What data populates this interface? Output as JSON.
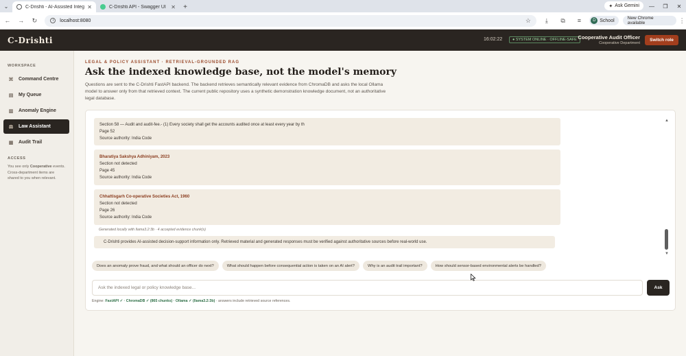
{
  "browser": {
    "tabs": [
      {
        "title": "C-Drishti - AI-Assisted Integrat",
        "active": true
      },
      {
        "title": "C-Drishti API - Swagger UI",
        "active": false
      }
    ],
    "ask_gemini": "Ask Gemini",
    "url": "localhost:8080",
    "profile_initial": "D",
    "profile_label": "School",
    "new_chrome": "New Chrome available"
  },
  "app": {
    "brand": "C-Drishti",
    "clock": "16:02:22",
    "system_status": "● SYSTEM ONLINE · OFFLINE-SAFE",
    "officer_name": "Cooperative Audit Officer",
    "officer_dept": "Cooperative Department",
    "switch_role": "Switch role"
  },
  "sidebar": {
    "section": "WORKSPACE",
    "items": [
      {
        "label": "Command Centre",
        "icon": "command-icon",
        "active": false
      },
      {
        "label": "My Queue",
        "icon": "queue-icon",
        "active": false
      },
      {
        "label": "Anomaly Engine",
        "icon": "chart-icon",
        "active": false
      },
      {
        "label": "Law Assistant",
        "icon": "scales-icon",
        "active": true
      },
      {
        "label": "Audit Trail",
        "icon": "trail-icon",
        "active": false
      }
    ],
    "access_title": "ACCESS",
    "access_pre": "You see only ",
    "access_role": "Cooperative",
    "access_post": " events. Cross-department items are shared to you when relevant."
  },
  "page": {
    "eyebrow": "LEGAL & POLICY ASSISTANT · RETRIEVAL-GROUNDED RAG",
    "title": "Ask the indexed knowledge base, not the model's memory",
    "description": "Questions are sent to the C-Drishti FastAPI backend. The backend retrieves semantically relevant evidence from ChromaDB and asks the local Ollama model to answer only from that retrieved context. The current public repository uses a synthetic demonstration knowledge document, not an authoritative legal database."
  },
  "evidence": [
    {
      "title": "",
      "lines": [
        "Section 58 — Audit and audit-fee.- (1) Every society shall get the accounts audited once at least every year by th",
        "Page 52",
        "Source authority: India Code"
      ]
    },
    {
      "title": "Bharatiya Sakshya Adhiniyam, 2023",
      "lines": [
        "Section not detected",
        "Page 45",
        "Source authority: India Code"
      ]
    },
    {
      "title": "Chhattisgarh Co-operative Societies Act, 1960",
      "lines": [
        "Section not detected",
        "Page 26",
        "Source authority: India Code"
      ]
    }
  ],
  "generated_note": "Generated locally with llama3.2:3b · 4 accepted evidence chunk(s)",
  "disclaimer": "C-Drishti provides AI-assisted decision-support information only. Retrieved material and generated responses must be verified against authoritative sources before real-world use.",
  "suggestions": [
    "Does an anomaly prove fraud, and what should an officer do next?",
    "What should happen before consequential action is taken on an AI alert?",
    "Why is an audit trail important?",
    "How should sensor-based environmental alerts be handled?"
  ],
  "ask": {
    "placeholder": "Ask the indexed legal or policy knowledge base...",
    "button": "Ask"
  },
  "engine": {
    "prefix": "Engine: ",
    "status": "FastAPI ✓ · ChromaDB ✓ (865 chunks) · Ollama ✓ (llama3.2:3b)",
    "suffix": " · answers include retrieved source references."
  }
}
